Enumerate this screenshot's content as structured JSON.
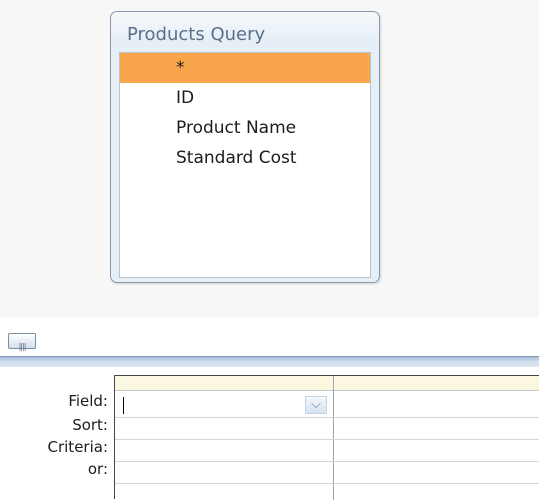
{
  "table": {
    "title": "Products Query",
    "fields": [
      "*",
      "ID",
      "Product Name",
      "Standard Cost"
    ],
    "selected_index": 0
  },
  "grid": {
    "row_labels": [
      "Field:",
      "Sort:",
      "Criteria:",
      "or:"
    ],
    "field_value": ""
  },
  "colors": {
    "selected_field": "#f9a54c",
    "title_text": "#5b6f8a",
    "grid_header": "#fbf7e0"
  },
  "icons": {
    "dropdown": "chevron-down-icon",
    "scroll_grip": "grip-icon"
  }
}
